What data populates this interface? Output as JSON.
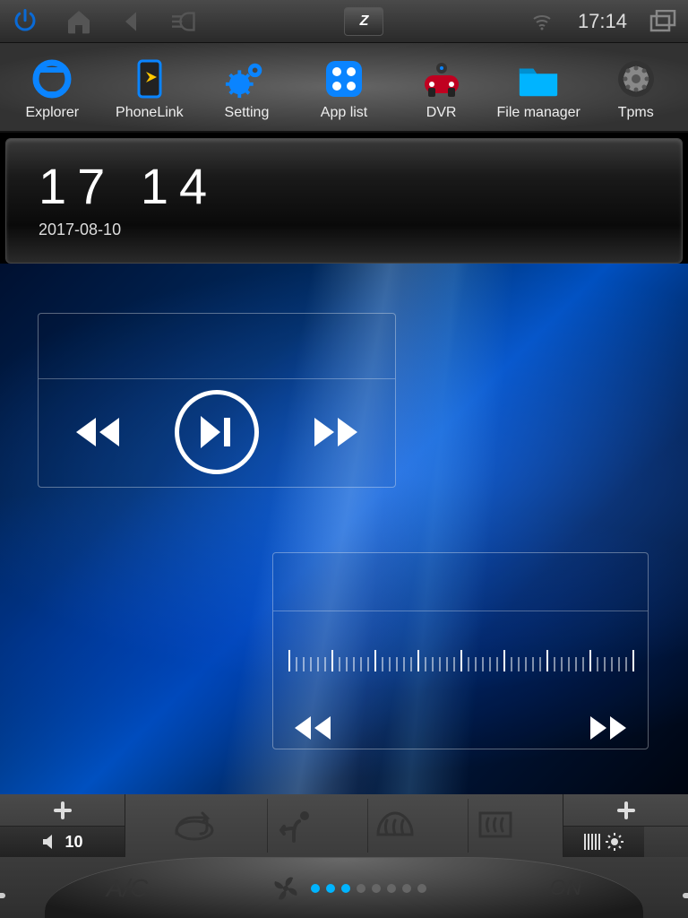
{
  "status": {
    "time": "17:14",
    "logo": "Z"
  },
  "apps": [
    {
      "label": "Explorer",
      "icon": "explorer"
    },
    {
      "label": "PhoneLink",
      "icon": "phonelink"
    },
    {
      "label": "Setting",
      "icon": "setting"
    },
    {
      "label": "App list",
      "icon": "applist"
    },
    {
      "label": "DVR",
      "icon": "dvr"
    },
    {
      "label": "File manager",
      "icon": "filemanager"
    },
    {
      "label": "Tpms",
      "icon": "tpms"
    }
  ],
  "clock": {
    "time": "17 14",
    "date": "2017-08-10"
  },
  "volume": {
    "value": "10"
  },
  "ac": {
    "label": "A/C",
    "on_label": "ON",
    "fan_level": 3,
    "fan_max": 8
  }
}
